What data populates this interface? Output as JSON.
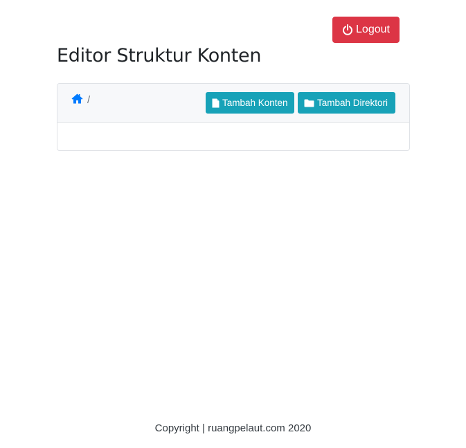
{
  "header": {
    "logout_label": "Logout",
    "logout_icon": "power-icon",
    "logout_color": "#dc3545"
  },
  "page": {
    "title": "Editor Struktur Konten"
  },
  "card": {
    "breadcrumb": {
      "home_icon": "home-icon",
      "separator": "/"
    },
    "actions": {
      "add_content_label": "Tambah Konten",
      "add_content_icon": "file-icon",
      "add_directory_label": "Tambah Direktori",
      "add_directory_icon": "folder-icon",
      "button_color": "#17a2b8"
    }
  },
  "footer": {
    "copyright": "Copyright | ruangpelaut.com 2020"
  }
}
